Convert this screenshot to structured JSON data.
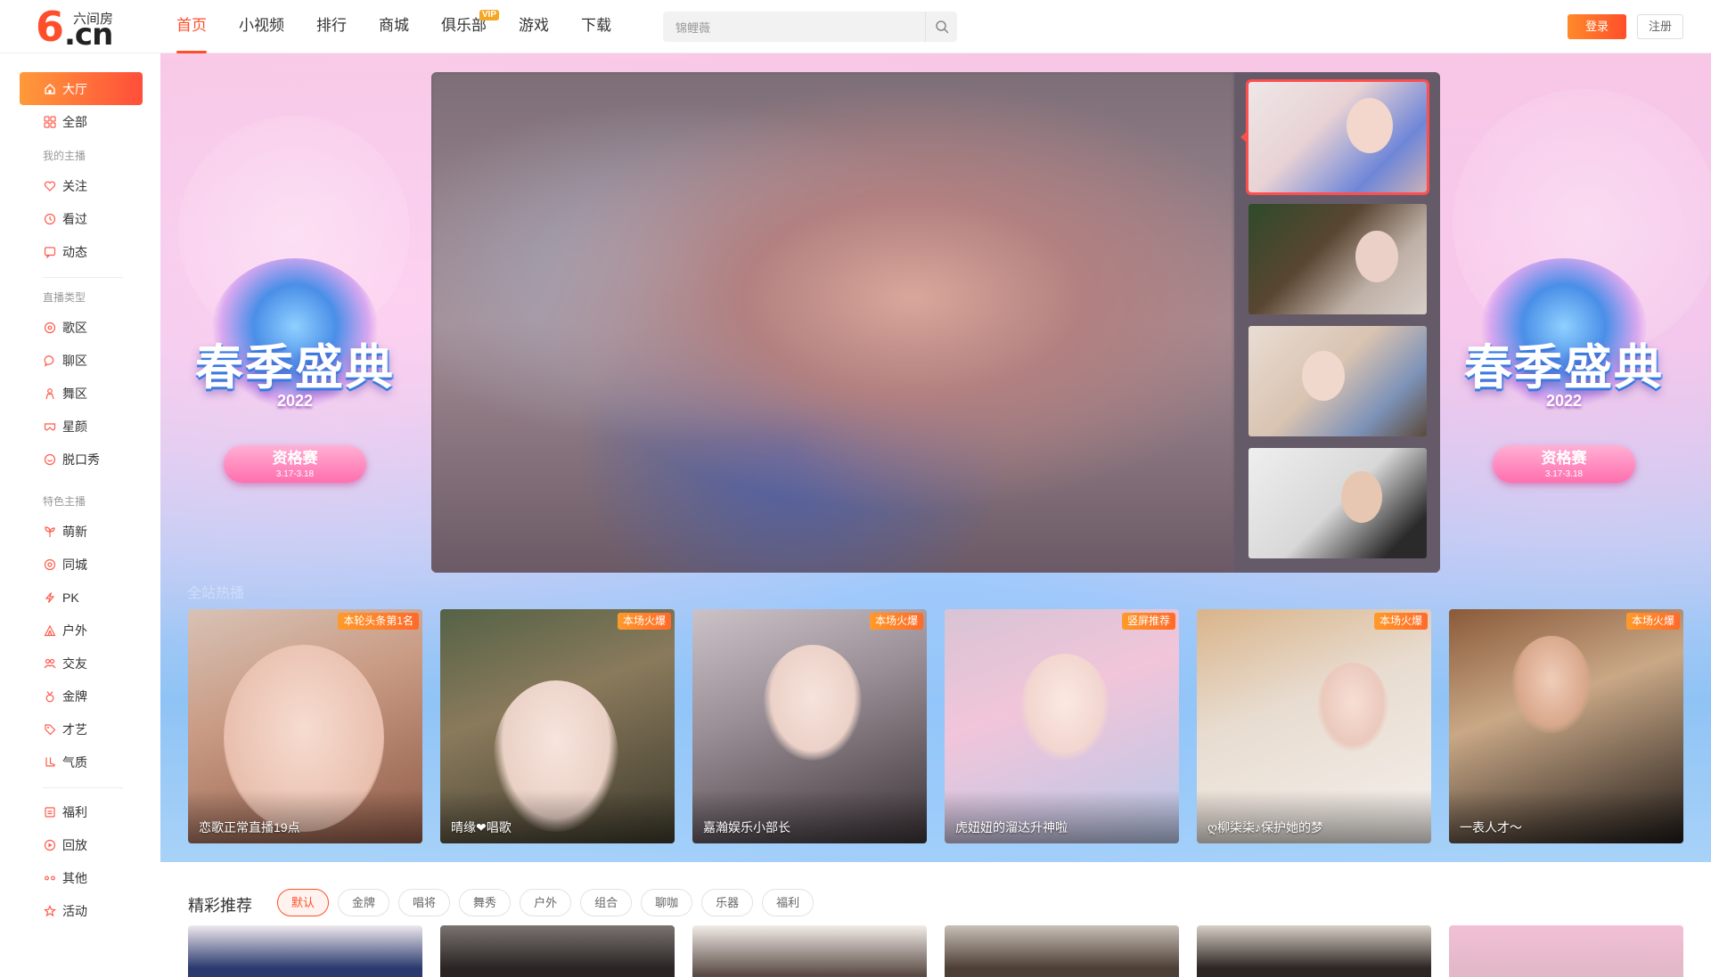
{
  "logo": {
    "mark": "6",
    "domain": ".cn",
    "subtitle": "六间房"
  },
  "nav": [
    {
      "label": "首页",
      "active": true
    },
    {
      "label": "小视频"
    },
    {
      "label": "排行"
    },
    {
      "label": "商城"
    },
    {
      "label": "俱乐部",
      "badge": "VIP"
    },
    {
      "label": "游戏"
    },
    {
      "label": "下载"
    }
  ],
  "search": {
    "value": "锦鲤薇"
  },
  "auth": {
    "login": "登录",
    "register": "注册"
  },
  "sidebar": {
    "hall": "大厅",
    "all": "全部",
    "my_section": "我的主播",
    "follow": "关注",
    "watched": "看过",
    "feed": "动态",
    "type_section": "直播类型",
    "singing": "歌区",
    "chat": "聊区",
    "dance": "舞区",
    "stars": "星颜",
    "talkshow": "脱口秀",
    "feature_section": "特色主播",
    "newbie": "萌新",
    "local": "同城",
    "pk": "PK",
    "outdoor": "户外",
    "dating": "交友",
    "gold": "金牌",
    "talent": "才艺",
    "temperament": "气质",
    "welfare": "福利",
    "replay": "回放",
    "other": "其他",
    "events": "活动"
  },
  "event_banner": {
    "title": "春季盛典",
    "year": "2022",
    "stage": "资格赛",
    "dates": "3.17-3.18"
  },
  "rooms_label": "全站热播",
  "rooms": [
    {
      "tag": "本轮头条第1名",
      "name": "恋歌正常直播19点"
    },
    {
      "tag": "本场火爆",
      "name": "晴缘❤唱歌"
    },
    {
      "tag": "本场火爆",
      "name": "嘉瀚娱乐小部长"
    },
    {
      "tag": "竖屏推荐",
      "name": "虎妞妞的溜达升神啦"
    },
    {
      "tag": "本场火爆",
      "name": "ღ柳柒柒♪保护她的梦"
    },
    {
      "tag": "本场火爆",
      "name": "一表人才～"
    }
  ],
  "recommend": {
    "title": "精彩推荐",
    "filters": [
      "默认",
      "金牌",
      "唱将",
      "舞秀",
      "户外",
      "组合",
      "聊咖",
      "乐器",
      "福利"
    ]
  },
  "colors": {
    "accent": "#ff4e2a",
    "vip": "#f5a623",
    "tag": "#ff7a2a"
  }
}
